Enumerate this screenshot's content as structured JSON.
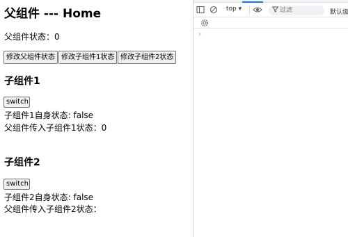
{
  "app": {
    "title": "父组件 --- Home",
    "parent_status_label": "父组件状态：",
    "parent_status_value": "0",
    "buttons": [
      {
        "label": "修改父组件状态"
      },
      {
        "label": "修改子组件1状态"
      },
      {
        "label": "修改子组件2状态"
      }
    ],
    "children": [
      {
        "heading": "子组件1",
        "switch_label": "switch",
        "self_label": "子组件1自身状态: ",
        "self_value": "false",
        "prop_label": "父组件传入子组件1状态：",
        "prop_value": "0"
      },
      {
        "heading": "子组件2",
        "switch_label": "switch",
        "self_label": "子组件2自身状态: ",
        "self_value": "false",
        "prop_label": "父组件传入子组件2状态：",
        "prop_value": ""
      }
    ]
  },
  "devtools": {
    "context": "top",
    "filter_placeholder": "过滤",
    "levels_label": "默认级别",
    "prompt_symbol": "›",
    "icons": [
      "sidebar-icon",
      "clear-console-icon",
      "chevron-down-icon",
      "eye-icon",
      "filter-icon",
      "gear-icon"
    ],
    "accent_color": "#1a73e8"
  }
}
